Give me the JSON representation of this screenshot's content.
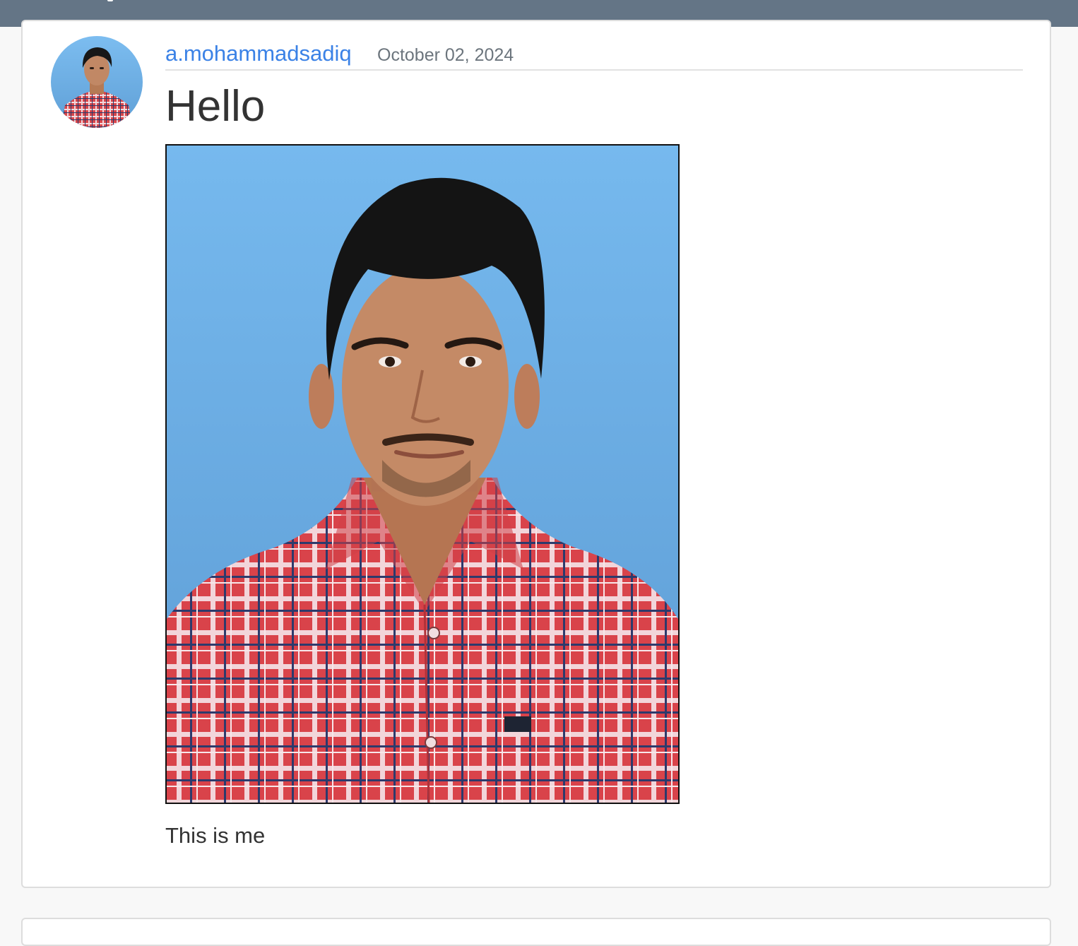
{
  "post": {
    "author": "a.mohammadsadiq",
    "date": "October 02, 2024",
    "title": "Hello",
    "body": "This is me"
  },
  "colors": {
    "topbar": "#647586",
    "link": "#3b82e6",
    "photo_background": "#6fb3e8",
    "shirt": "#d9474b"
  },
  "icons": {
    "avatar": "user-photo-avatar",
    "post_image": "portrait-photo"
  }
}
